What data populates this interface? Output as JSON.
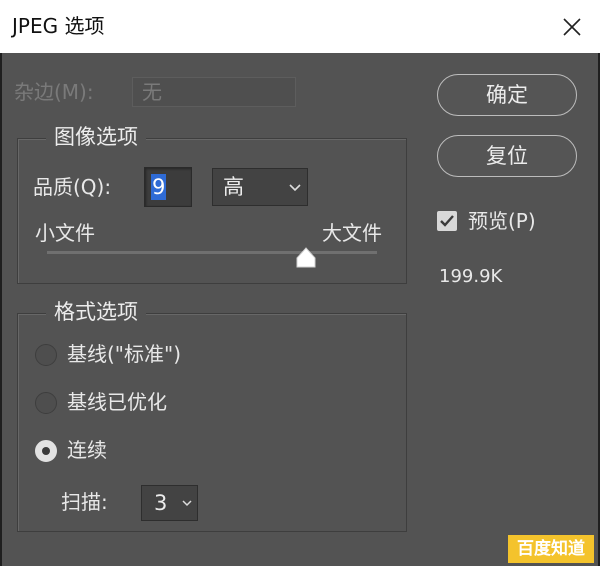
{
  "window": {
    "title": "JPEG 选项",
    "close_icon": "close-icon"
  },
  "matte": {
    "label": "杂边(M):",
    "value": "无",
    "enabled": false
  },
  "image_options": {
    "legend": "图像选项",
    "quality_label": "品质(Q):",
    "quality_value": "9",
    "quality_preset": "高",
    "slider_min_label": "小文件",
    "slider_max_label": "大文件",
    "quality_fraction": 0.75
  },
  "buttons": {
    "ok": "确定",
    "reset": "复位"
  },
  "preview": {
    "label": "预览(P)",
    "checked": true,
    "file_size": "199.9K"
  },
  "format_options": {
    "legend": "格式选项",
    "options": [
      {
        "label": "基线(\"标准\")",
        "selected": false
      },
      {
        "label": "基线已优化",
        "selected": false
      },
      {
        "label": "连续",
        "selected": true
      }
    ],
    "scans_label": "扫描:",
    "scans_value": "3"
  },
  "watermark": {
    "text": "百度知道"
  },
  "colors": {
    "background": "#535353",
    "selection": "#2f6bd5",
    "watermark": "#f4c32c"
  }
}
